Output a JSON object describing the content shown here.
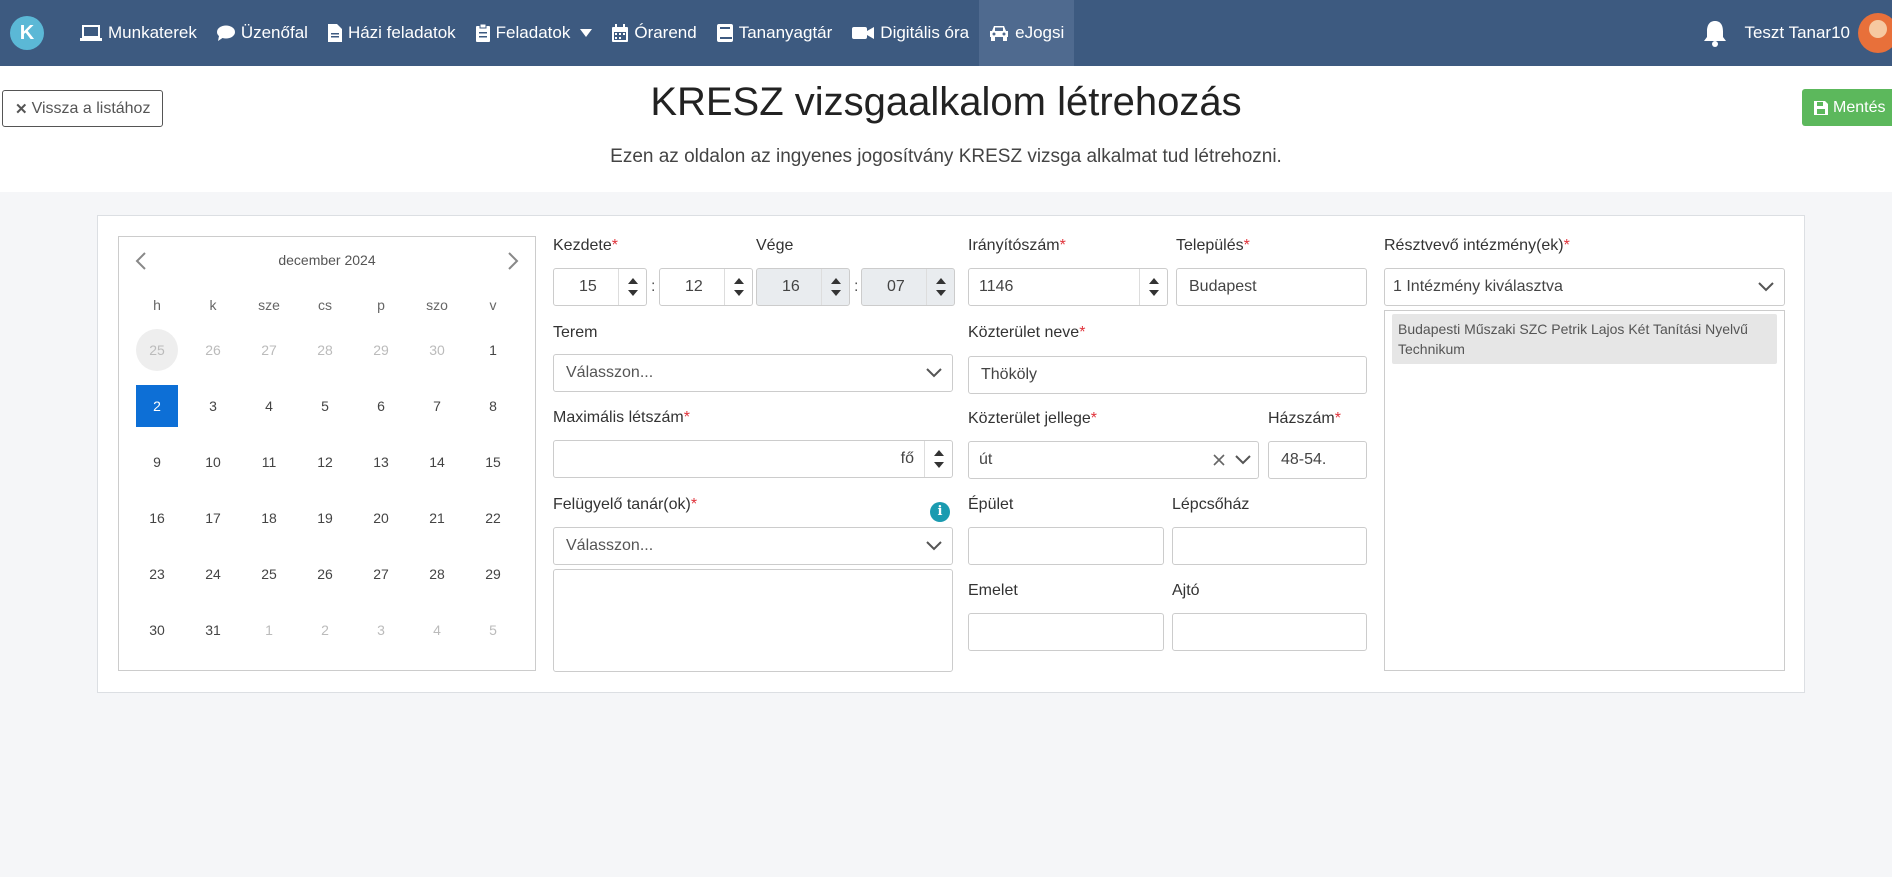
{
  "nav": {
    "brand": "K",
    "items": [
      {
        "label": "Munkaterek",
        "icon": "laptop-icon"
      },
      {
        "label": "Üzenőfal",
        "icon": "comment-icon"
      },
      {
        "label": "Házi feladatok",
        "icon": "file-icon"
      },
      {
        "label": "Feladatok",
        "icon": "clipboard-icon"
      },
      {
        "label": "Órarend",
        "icon": "calendar-icon"
      },
      {
        "label": "Tananyagtár",
        "icon": "book-icon"
      },
      {
        "label": "Digitális óra",
        "icon": "video-icon"
      },
      {
        "label": "eJogsi",
        "icon": "car-icon"
      }
    ],
    "user": "Teszt Tanar10"
  },
  "header": {
    "back_label": "Vissza a listához",
    "title": "KRESZ vizsgaalkalom létrehozás",
    "subtitle": "Ezen az oldalon az ingyenes jogosítvány KRESZ vizsga alkalmat tud létrehozni.",
    "save_label": "Mentés"
  },
  "calendar": {
    "month": "december 2024",
    "weekdays": [
      "h",
      "k",
      "sze",
      "cs",
      "p",
      "szo",
      "v"
    ],
    "weeks": [
      [
        "25",
        "26",
        "27",
        "28",
        "29",
        "30",
        "1"
      ],
      [
        "2",
        "3",
        "4",
        "5",
        "6",
        "7",
        "8"
      ],
      [
        "9",
        "10",
        "11",
        "12",
        "13",
        "14",
        "15"
      ],
      [
        "16",
        "17",
        "18",
        "19",
        "20",
        "21",
        "22"
      ],
      [
        "23",
        "24",
        "25",
        "26",
        "27",
        "28",
        "29"
      ],
      [
        "30",
        "31",
        "1",
        "2",
        "3",
        "4",
        "5"
      ]
    ],
    "selected": "2"
  },
  "form": {
    "start": {
      "label": "Kezdete",
      "hour": "15",
      "minute": "12"
    },
    "end": {
      "label": "Vége",
      "hour": "16",
      "minute": "07"
    },
    "room": {
      "label": "Terem",
      "placeholder": "Válasszon..."
    },
    "max_count": {
      "label": "Maximális létszám",
      "value": "",
      "suffix": "fő"
    },
    "supervisor": {
      "label": "Felügyelő tanár(ok)",
      "placeholder": "Válasszon..."
    },
    "zip": {
      "label": "Irányítószám",
      "value": "1146"
    },
    "city": {
      "label": "Település",
      "value": "Budapest"
    },
    "street_name": {
      "label": "Közterület neve",
      "value": "Thököly"
    },
    "street_type": {
      "label": "Közterület jellege",
      "value": "út"
    },
    "house_no": {
      "label": "Házszám",
      "value": "48-54."
    },
    "building": {
      "label": "Épület",
      "value": ""
    },
    "stairway": {
      "label": "Lépcsőház",
      "value": ""
    },
    "floor": {
      "label": "Emelet",
      "value": ""
    },
    "door": {
      "label": "Ajtó",
      "value": ""
    },
    "institutions": {
      "label": "Résztvevő intézmény(ek)",
      "selected_summary": "1 Intézmény kiválasztva",
      "items": [
        "Budapesti Műszaki SZC Petrik Lajos Két Tanítási Nyelvű Technikum"
      ]
    },
    "required_mark": "*"
  }
}
